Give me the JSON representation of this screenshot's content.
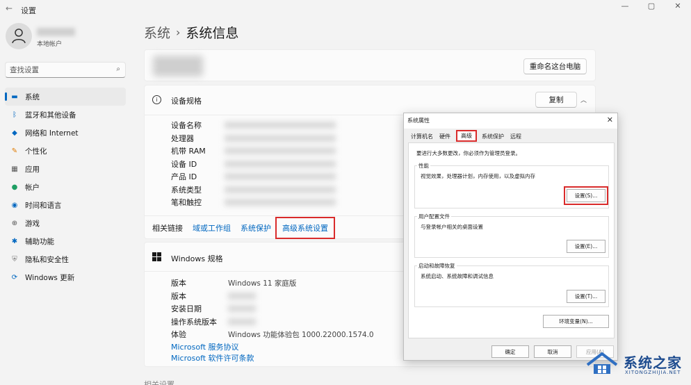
{
  "window": {
    "title": "设置",
    "back_glyph": "←",
    "controls": [
      "—",
      "▢",
      "✕"
    ]
  },
  "account": {
    "type": "本地帐户"
  },
  "search": {
    "placeholder": "查找设置"
  },
  "sidebar": {
    "items": [
      {
        "label": "系统",
        "icon": "monitor-icon",
        "color": "#0067c0",
        "active": true
      },
      {
        "label": "蓝牙和其他设备",
        "icon": "bluetooth-icon",
        "color": "#0067c0"
      },
      {
        "label": "网络和 Internet",
        "icon": "wifi-icon",
        "color": "#0067c0"
      },
      {
        "label": "个性化",
        "icon": "brush-icon",
        "color": "#e07b00"
      },
      {
        "label": "应用",
        "icon": "apps-icon",
        "color": "#555555"
      },
      {
        "label": "帐户",
        "icon": "person-icon",
        "color": "#1e9e63"
      },
      {
        "label": "时间和语言",
        "icon": "globe-icon",
        "color": "#0067c0"
      },
      {
        "label": "游戏",
        "icon": "gamepad-icon",
        "color": "#555555"
      },
      {
        "label": "辅助功能",
        "icon": "accessibility-icon",
        "color": "#0067c0"
      },
      {
        "label": "隐私和安全性",
        "icon": "shield-icon",
        "color": "#777777"
      },
      {
        "label": "Windows 更新",
        "icon": "update-icon",
        "color": "#0067c0"
      }
    ]
  },
  "breadcrumb": {
    "parent": "系统",
    "separator": "›",
    "current": "系统信息"
  },
  "pc": {
    "rename_label": "重命名这台电脑"
  },
  "device_specs": {
    "title": "设备规格",
    "copy_label": "复制",
    "labels": [
      "设备名称",
      "处理器",
      "机带 RAM",
      "设备 ID",
      "产品 ID",
      "系统类型",
      "笔和触控"
    ],
    "values": [
      "",
      "",
      "",
      "",
      "",
      "",
      ""
    ]
  },
  "related": {
    "label": "相关链接",
    "links": [
      "域或工作组",
      "系统保护",
      "高级系统设置"
    ]
  },
  "windows_specs": {
    "title": "Windows 规格",
    "labels": [
      "版本",
      "版本",
      "安装日期",
      "操作系统版本",
      "体验"
    ],
    "values": [
      "Windows 11 家庭版",
      "",
      "",
      "",
      "Windows 功能体验包 1000.22000.1574.0"
    ],
    "links": [
      "Microsoft 服务协议",
      "Microsoft 软件许可条款"
    ]
  },
  "footer": {
    "partial_text": "相关设置"
  },
  "dialog": {
    "title": "系统属性",
    "close": "✕",
    "tabs": [
      "计算机名",
      "硬件",
      "高级",
      "系统保护",
      "远程"
    ],
    "selected_tab": 2,
    "note": "要进行大多数更改，你必须作为管理员登录。",
    "performance": {
      "title": "性能",
      "desc": "视觉效果，处理器计划，内存使用，以及虚拟内存",
      "button": "设置(S)..."
    },
    "profile": {
      "title": "用户配置文件",
      "desc": "与登录帐户相关的桌面设置",
      "button": "设置(E)..."
    },
    "startup": {
      "title": "启动和故障恢复",
      "desc": "系统启动、系统故障和调试信息",
      "button": "设置(T)..."
    },
    "env_button": "环境变量(N)...",
    "ok": "确定",
    "cancel": "取消",
    "apply": "应用(A)"
  },
  "watermark": {
    "text": "系统之家",
    "sub": "XITONGZHIJIA.NET"
  }
}
